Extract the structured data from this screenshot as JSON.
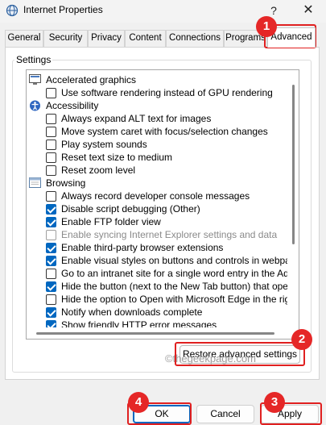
{
  "window": {
    "title": "Internet Properties",
    "help_label": "?",
    "close_label": "✕"
  },
  "tabs": [
    {
      "label": "General"
    },
    {
      "label": "Security"
    },
    {
      "label": "Privacy"
    },
    {
      "label": "Content"
    },
    {
      "label": "Connections"
    },
    {
      "label": "Programs"
    },
    {
      "label": "Advanced",
      "active": true
    }
  ],
  "settings": {
    "group_label": "Settings",
    "rows": [
      {
        "type": "category",
        "label": "Accelerated graphics",
        "icon": "monitor-icon"
      },
      {
        "type": "option",
        "label": "Use software rendering instead of GPU rendering",
        "checked": false
      },
      {
        "type": "category",
        "label": "Accessibility",
        "icon": "accessibility-icon"
      },
      {
        "type": "option",
        "label": "Always expand ALT text for images",
        "checked": false
      },
      {
        "type": "option",
        "label": "Move system caret with focus/selection changes",
        "checked": false
      },
      {
        "type": "option",
        "label": "Play system sounds",
        "checked": false
      },
      {
        "type": "option",
        "label": "Reset text size to medium",
        "checked": false
      },
      {
        "type": "option",
        "label": "Reset zoom level",
        "checked": false
      },
      {
        "type": "category",
        "label": "Browsing",
        "icon": "browser-window-icon"
      },
      {
        "type": "option",
        "label": "Always record developer console messages",
        "checked": false
      },
      {
        "type": "option",
        "label": "Disable script debugging (Other)",
        "checked": true
      },
      {
        "type": "option",
        "label": "Enable FTP folder view",
        "checked": true
      },
      {
        "type": "option",
        "label": "Enable syncing Internet Explorer settings and data",
        "checked": false,
        "disabled": true
      },
      {
        "type": "option",
        "label": "Enable third-party browser extensions",
        "checked": true
      },
      {
        "type": "option",
        "label": "Enable visual styles on buttons and controls in webpages",
        "checked": true
      },
      {
        "type": "option",
        "label": "Go to an intranet site for a single word entry in the Addres",
        "checked": false
      },
      {
        "type": "option",
        "label": "Hide the button (next to the New Tab button) that opens",
        "checked": true
      },
      {
        "type": "option",
        "label": "Hide the option to Open with Microsoft Edge in the right-cl",
        "checked": false
      },
      {
        "type": "option",
        "label": "Notify when downloads complete",
        "checked": true
      },
      {
        "type": "option",
        "label": "Show friendly HTTP error messages",
        "checked": true
      }
    ]
  },
  "buttons": {
    "restore": "Restore advanced settings",
    "ok": "OK",
    "cancel": "Cancel",
    "apply": "Apply"
  },
  "watermark": "©thegeekpage.com",
  "callouts": [
    {
      "number": "1"
    },
    {
      "number": "2"
    },
    {
      "number": "3"
    },
    {
      "number": "4"
    }
  ],
  "colors": {
    "accent": "#0067c0",
    "callout": "#e52727"
  }
}
